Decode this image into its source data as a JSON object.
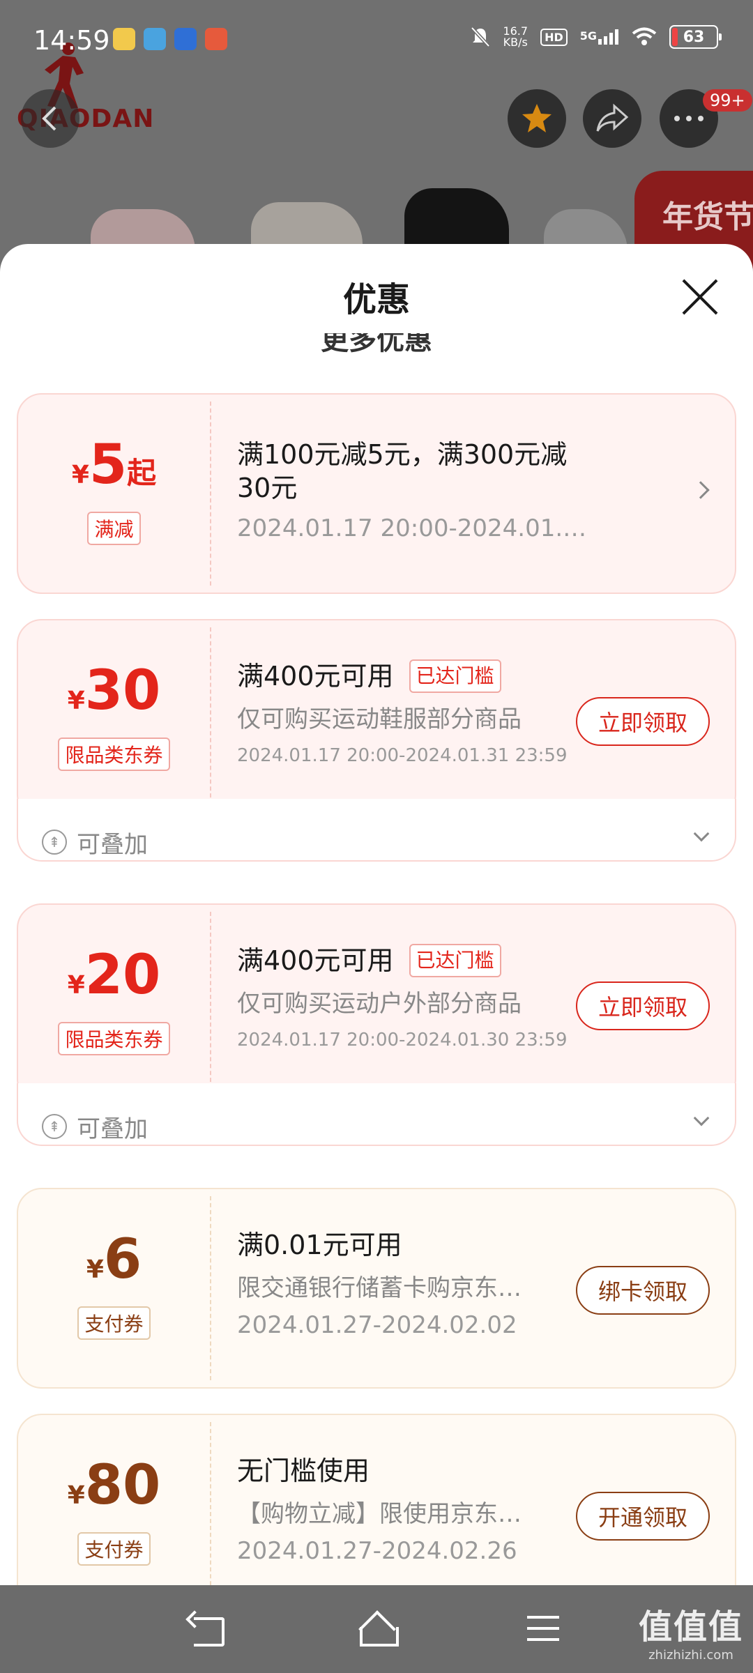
{
  "status": {
    "time": "14:59",
    "net_speed_value": "16.7",
    "net_speed_unit": "KB/s",
    "hd": "HD",
    "signal": "5G",
    "battery": "63"
  },
  "header": {
    "brand": "QIAODAN",
    "badge": "99+",
    "festival_text": "年货节"
  },
  "sheet": {
    "title": "优惠",
    "more_label": "更多优惠"
  },
  "coupons": [
    {
      "yen": "¥",
      "amount": "5",
      "suffix": "起",
      "tag": "满减",
      "condition": "满100元减5元，满300元减30元",
      "date": "2024.01.17 20:00-2024.01.3…"
    },
    {
      "yen": "¥",
      "amount": "30",
      "tag": "限品类东券",
      "condition": "满400元可用",
      "reached": "已达门槛",
      "description": "仅可购买运动鞋服部分商品",
      "date": "2024.01.17 20:00-2024.01.31 23:59",
      "action": "立即领取",
      "stack_label": "可叠加"
    },
    {
      "yen": "¥",
      "amount": "20",
      "tag": "限品类东券",
      "condition": "满400元可用",
      "reached": "已达门槛",
      "description": "仅可购买运动户外部分商品",
      "date": "2024.01.17 20:00-2024.01.30 23:59",
      "action": "立即领取",
      "stack_label": "可叠加"
    },
    {
      "yen": "¥",
      "amount": "6",
      "tag": "支付券",
      "condition": "满0.01元可用",
      "description": "限交通银行储蓄卡购京东…",
      "date": "2024.01.27-2024.02.02",
      "action": "绑卡领取"
    },
    {
      "yen": "¥",
      "amount": "80",
      "tag": "支付券",
      "condition": "无门槛使用",
      "description": "【购物立减】限使用京东…",
      "date": "2024.01.27-2024.02.26",
      "action": "开通领取"
    }
  ],
  "watermark": {
    "big": "值值值",
    "small": "zhizhizhi.com"
  },
  "colors": {
    "accent_red": "#e3251b",
    "accent_brown": "#8a3e14"
  }
}
